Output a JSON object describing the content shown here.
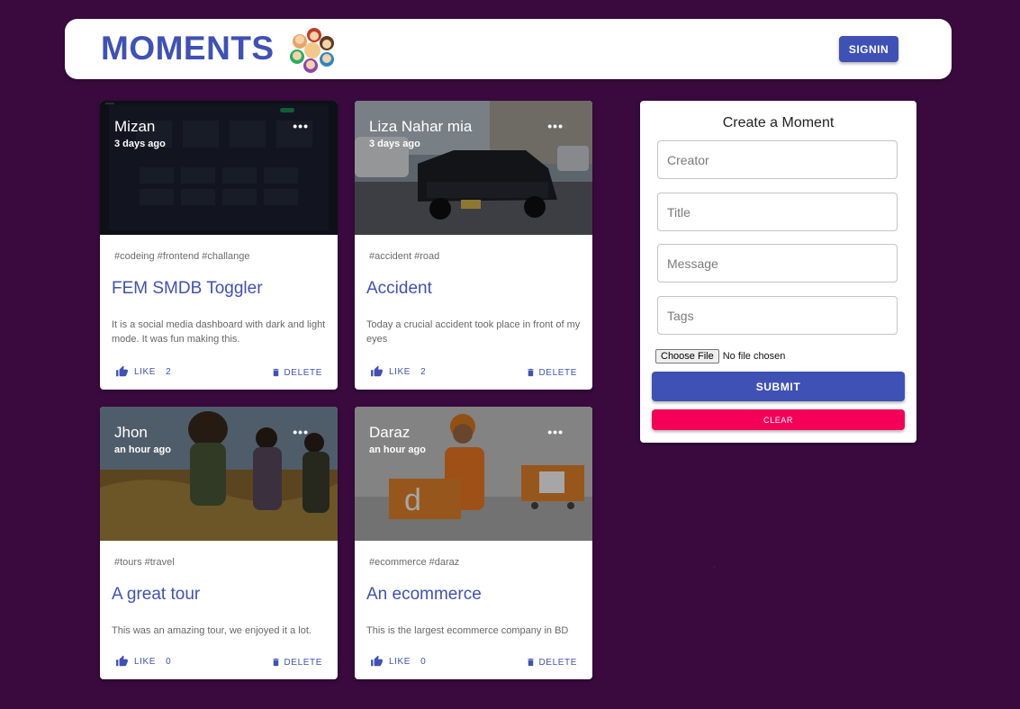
{
  "header": {
    "brand": "MOMENTS",
    "logo_icon": "people-circle-logo",
    "signin_label": "SIGNIN"
  },
  "colors": {
    "primary": "#3f51b5",
    "secondary": "#f50057",
    "background": "#3a0a3f"
  },
  "posts": [
    {
      "creator": "Mizan",
      "time": "3 days ago",
      "tags": "#codeing #frontend #challange",
      "title": "FEM SMDB Toggler",
      "message": "It is a social media dashboard with dark and light mode. It was fun making this.",
      "like_label": "LIKE",
      "like_count": "2",
      "delete_label": "DELETE",
      "more": "•••"
    },
    {
      "creator": "Liza Nahar mia",
      "time": "3 days ago",
      "tags": "#accident #road",
      "title": "Accident",
      "message": "Today a crucial accident took place in front of my eyes",
      "like_label": "LIKE",
      "like_count": "2",
      "delete_label": "DELETE",
      "more": "•••"
    },
    {
      "creator": "Jhon",
      "time": "an hour ago",
      "tags": "#tours #travel",
      "title": "A great tour",
      "message": "This was an amazing tour, we enjoyed it a lot.",
      "like_label": "LIKE",
      "like_count": "0",
      "delete_label": "DELETE",
      "more": "•••"
    },
    {
      "creator": "Daraz",
      "time": "an hour ago",
      "tags": "#ecommerce #daraz",
      "title": "An ecommerce",
      "message": "This is the largest ecommerce company in BD",
      "like_label": "LIKE",
      "like_count": "0",
      "delete_label": "DELETE",
      "more": "•••"
    }
  ],
  "form": {
    "title": "Create a Moment",
    "creator_placeholder": "Creator",
    "title_placeholder": "Title",
    "message_placeholder": "Message",
    "tags_placeholder": "Tags",
    "file_button": "Choose File",
    "file_status": "No file chosen",
    "submit_label": "SUBMIT",
    "clear_label": "CLEAR"
  }
}
